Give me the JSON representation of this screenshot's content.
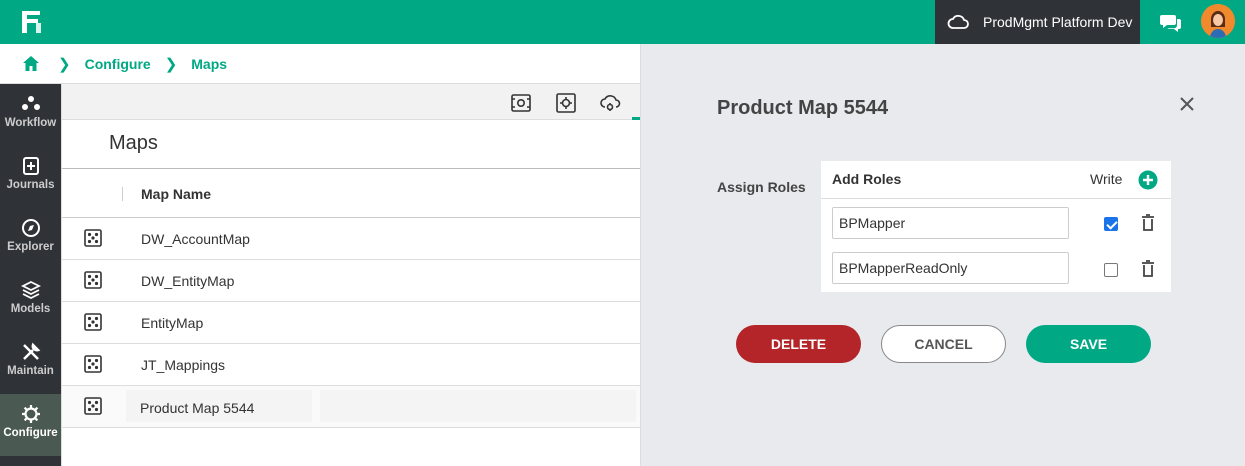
{
  "header": {
    "environment": "ProdMgmt Platform Dev",
    "colors": {
      "brand": "#00a884",
      "dark": "#2f3338"
    }
  },
  "breadcrumb": {
    "items": [
      "Configure",
      "Maps"
    ]
  },
  "nav": {
    "items": [
      {
        "label": "Workflow",
        "icon": "workflow-icon"
      },
      {
        "label": "Journals",
        "icon": "journals-icon"
      },
      {
        "label": "Explorer",
        "icon": "compass-icon"
      },
      {
        "label": "Models",
        "icon": "layers-icon"
      },
      {
        "label": "Maintain",
        "icon": "tools-icon"
      },
      {
        "label": "Configure",
        "icon": "gear-icon",
        "active": true
      }
    ]
  },
  "main": {
    "title": "Maps",
    "column_header": "Map Name",
    "rows": [
      "DW_AccountMap",
      "DW_EntityMap",
      "EntityMap",
      "JT_Mappings",
      "Product Map 5544"
    ]
  },
  "panel": {
    "title": "Product Map 5544",
    "assign_label": "Assign Roles",
    "roles_header": "Add Roles",
    "write_header": "Write",
    "roles": [
      {
        "name": "BPMapper",
        "write": true
      },
      {
        "name": "BPMapperReadOnly",
        "write": false
      }
    ],
    "buttons": {
      "delete": "DELETE",
      "cancel": "CANCEL",
      "save": "SAVE"
    },
    "colors": {
      "delete": "#b32528",
      "save": "#00a884",
      "checkbox": "#1a73e8"
    }
  }
}
